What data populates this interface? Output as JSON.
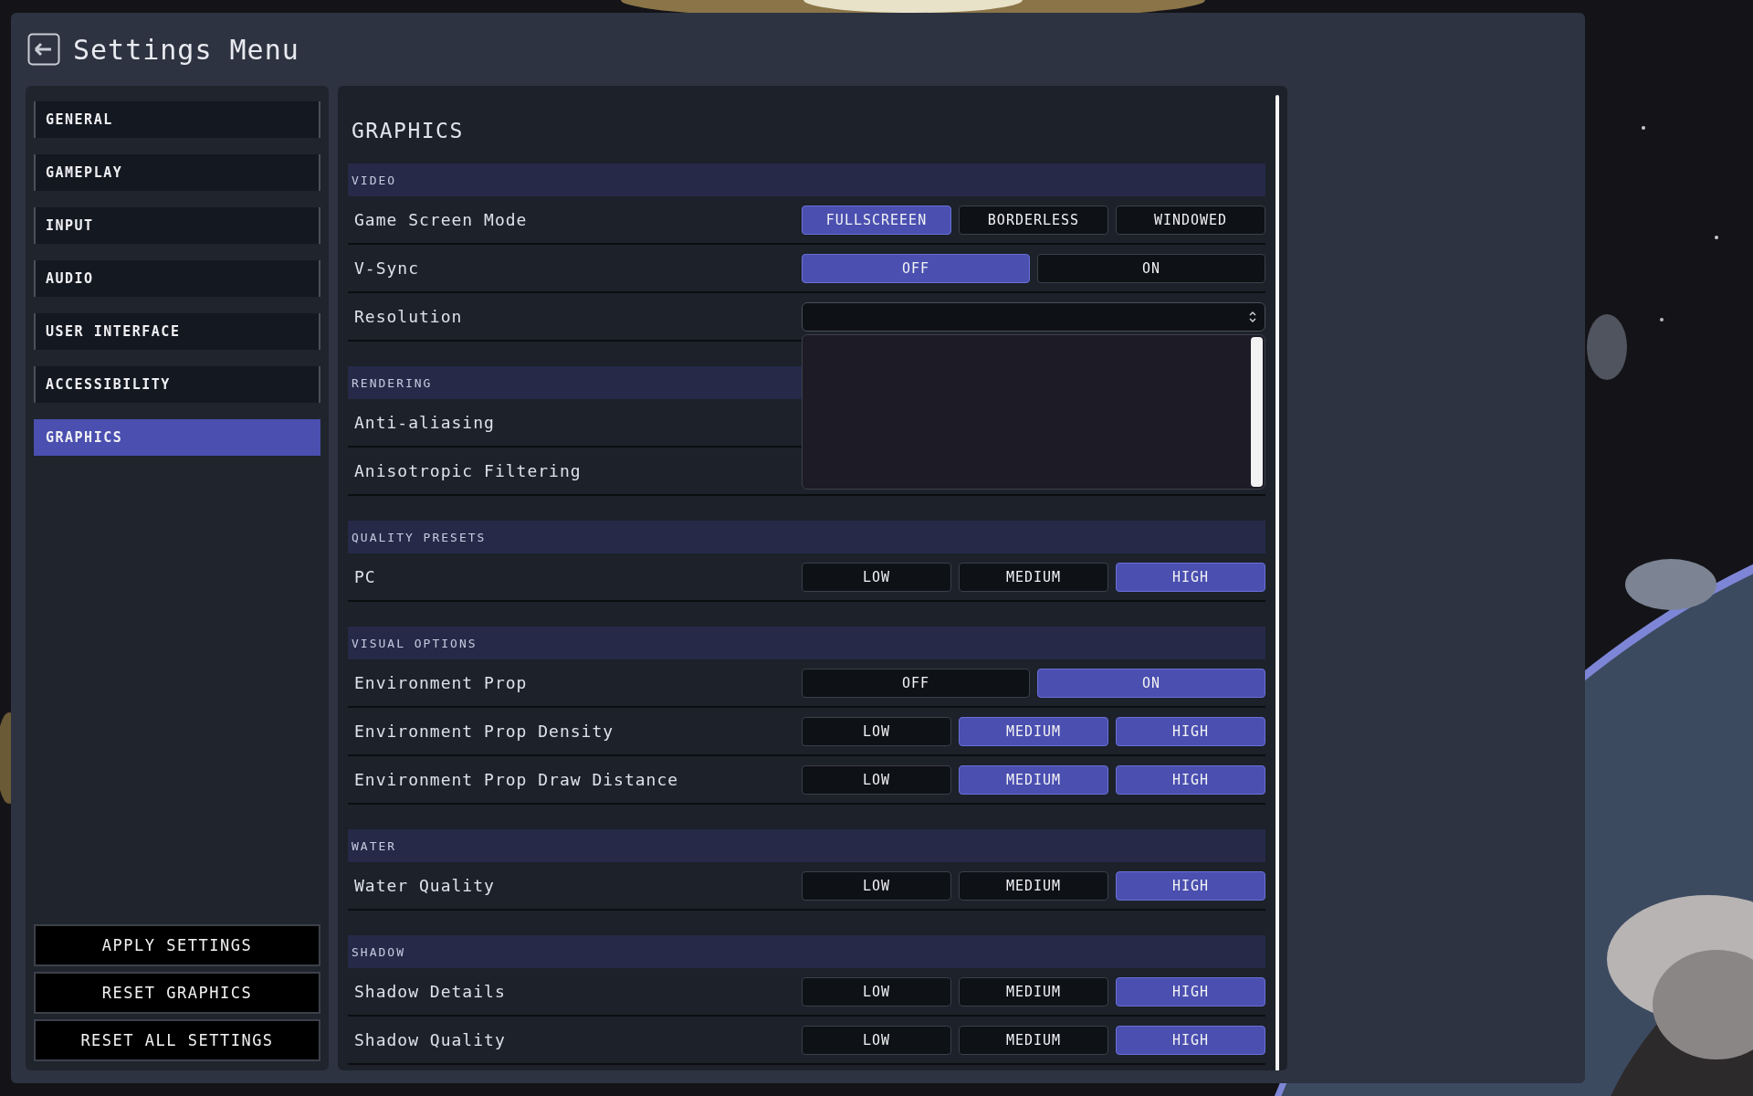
{
  "window": {
    "title": "Settings Menu"
  },
  "sidebar": {
    "items": [
      {
        "label": "GENERAL",
        "selected": false
      },
      {
        "label": "GAMEPLAY",
        "selected": false
      },
      {
        "label": "INPUT",
        "selected": false
      },
      {
        "label": "AUDIO",
        "selected": false
      },
      {
        "label": "USER INTERFACE",
        "selected": false
      },
      {
        "label": "ACCESSIBILITY",
        "selected": false
      },
      {
        "label": "GRAPHICS",
        "selected": true
      }
    ],
    "buttons": [
      "APPLY SETTINGS",
      "RESET GRAPHICS",
      "RESET ALL SETTINGS"
    ]
  },
  "content": {
    "title": "GRAPHICS",
    "sections": [
      {
        "title": "VIDEO",
        "rows": [
          {
            "label": "Game Screen Mode",
            "kind": "options",
            "options": [
              {
                "label": "FULLSCREEEN",
                "selected": true
              },
              {
                "label": "BORDERLESS",
                "selected": false
              },
              {
                "label": "WINDOWED",
                "selected": false
              }
            ]
          },
          {
            "label": "V-Sync",
            "kind": "options",
            "options": [
              {
                "label": "OFF",
                "selected": true
              },
              {
                "label": "ON",
                "selected": false
              }
            ]
          },
          {
            "label": "Resolution",
            "kind": "select",
            "expanded": true
          }
        ]
      },
      {
        "title": "RENDERING",
        "rows": [
          {
            "label": "Anti-aliasing",
            "kind": "plain"
          },
          {
            "label": "Anisotropic Filtering",
            "kind": "plain"
          }
        ]
      },
      {
        "title": "QUALITY PRESETS",
        "rows": [
          {
            "label": "PC",
            "kind": "options",
            "options": [
              {
                "label": "LOW",
                "selected": false
              },
              {
                "label": "MEDIUM",
                "selected": false
              },
              {
                "label": "HIGH",
                "selected": true
              }
            ]
          }
        ]
      },
      {
        "title": "VISUAL OPTIONS",
        "rows": [
          {
            "label": "Environment Prop",
            "kind": "options",
            "options": [
              {
                "label": "OFF",
                "selected": false
              },
              {
                "label": "ON",
                "selected": true
              }
            ]
          },
          {
            "label": "Environment Prop Density",
            "kind": "options",
            "options": [
              {
                "label": "LOW",
                "selected": false
              },
              {
                "label": "MEDIUM",
                "selected": true
              },
              {
                "label": "HIGH",
                "selected": true
              }
            ]
          },
          {
            "label": "Environment Prop Draw Distance",
            "kind": "options",
            "options": [
              {
                "label": "LOW",
                "selected": false
              },
              {
                "label": "MEDIUM",
                "selected": true
              },
              {
                "label": "HIGH",
                "selected": true
              }
            ]
          }
        ]
      },
      {
        "title": "WATER",
        "rows": [
          {
            "label": "Water Quality",
            "kind": "options",
            "options": [
              {
                "label": "LOW",
                "selected": false
              },
              {
                "label": "MEDIUM",
                "selected": false
              },
              {
                "label": "HIGH",
                "selected": true
              }
            ]
          }
        ]
      },
      {
        "title": "SHADOW",
        "rows": [
          {
            "label": "Shadow Details",
            "kind": "options",
            "options": [
              {
                "label": "LOW",
                "selected": false
              },
              {
                "label": "MEDIUM",
                "selected": false
              },
              {
                "label": "HIGH",
                "selected": true
              }
            ]
          },
          {
            "label": "Shadow Quality",
            "kind": "options",
            "options": [
              {
                "label": "LOW",
                "selected": false
              },
              {
                "label": "MEDIUM",
                "selected": false
              },
              {
                "label": "HIGH",
                "selected": true
              }
            ]
          }
        ]
      }
    ]
  }
}
